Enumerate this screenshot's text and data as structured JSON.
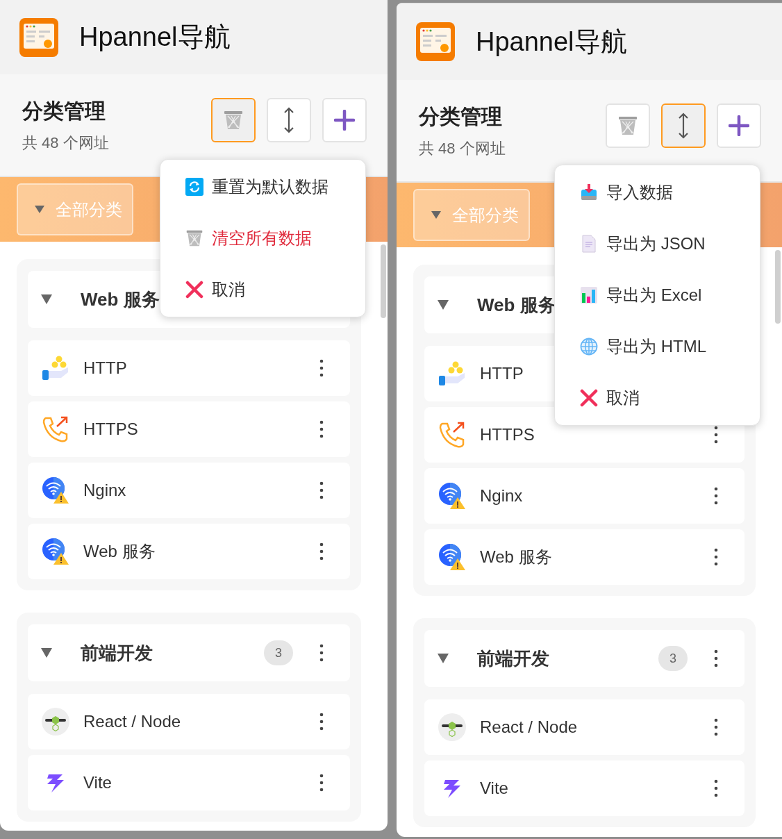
{
  "panels": [
    {
      "app_title": "Hpannel导航",
      "section_title": "分类管理",
      "section_subtitle": "共 48 个网址",
      "toolbar": [
        {
          "kind": "trash",
          "selected": true
        },
        {
          "kind": "sort",
          "selected": false
        },
        {
          "kind": "add",
          "selected": false
        }
      ],
      "category_filter": "全部分类",
      "groups": [
        {
          "name": "Web 服务",
          "expanded": true,
          "more_button": false,
          "items": [
            {
              "kind": "coins",
              "label": "HTTP"
            },
            {
              "kind": "phone",
              "label": "HTTPS"
            },
            {
              "kind": "wifi-warning",
              "label": "Nginx"
            },
            {
              "kind": "wifi-warning",
              "label": "Web 服务"
            }
          ]
        },
        {
          "name": "前端开发",
          "count": "3",
          "expanded": true,
          "items": [
            {
              "kind": "node",
              "label": "React / Node"
            },
            {
              "kind": "bolt",
              "label": "Vite"
            }
          ]
        }
      ],
      "menu": [
        {
          "kind": "reset",
          "label": "重置为默认数据",
          "danger": false
        },
        {
          "kind": "trash",
          "label": "清空所有数据",
          "danger": true
        },
        {
          "kind": "cancel",
          "label": "取消",
          "danger": false
        }
      ]
    },
    {
      "app_title": "Hpannel导航",
      "section_title": "分类管理",
      "section_subtitle": "共 48 个网址",
      "toolbar": [
        {
          "kind": "trash",
          "selected": false
        },
        {
          "kind": "sort",
          "selected": true
        },
        {
          "kind": "add",
          "selected": false
        }
      ],
      "category_filter": "全部分类",
      "groups": [
        {
          "name": "Web 服务",
          "expanded": true,
          "more_button": false,
          "items": [
            {
              "kind": "coins",
              "label": "HTTP",
              "more_button": false
            },
            {
              "kind": "phone",
              "label": "HTTPS"
            },
            {
              "kind": "wifi-warning",
              "label": "Nginx"
            },
            {
              "kind": "wifi-warning",
              "label": "Web 服务"
            }
          ]
        },
        {
          "name": "前端开发",
          "count": "3",
          "expanded": true,
          "items": [
            {
              "kind": "node",
              "label": "React / Node"
            },
            {
              "kind": "bolt",
              "label": "Vite"
            }
          ]
        }
      ],
      "menu": [
        {
          "kind": "import",
          "label": "导入数据",
          "danger": false
        },
        {
          "kind": "json",
          "label": "导出为 JSON",
          "danger": false
        },
        {
          "kind": "excel",
          "label": "导出为 Excel",
          "danger": false
        },
        {
          "kind": "html",
          "label": "导出为 HTML",
          "danger": false
        },
        {
          "kind": "cancel",
          "label": "取消",
          "danger": false
        }
      ]
    }
  ]
}
